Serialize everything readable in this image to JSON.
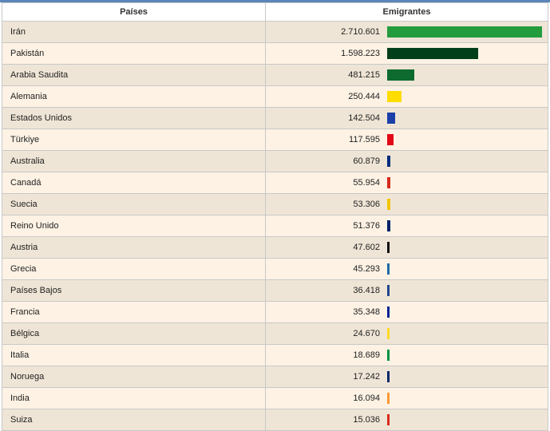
{
  "table": {
    "headers": [
      "Países",
      "Emigrantes"
    ]
  },
  "chart_data": {
    "type": "bar",
    "orientation": "horizontal",
    "xlabel": "",
    "ylabel": "",
    "categories": [
      "Irán",
      "Pakistán",
      "Arabia Saudita",
      "Alemania",
      "Estados Unidos",
      "Türkiye",
      "Australia",
      "Canadá",
      "Suecia",
      "Reino Unido",
      "Austria",
      "Grecia",
      "Países Bajos",
      "Francia",
      "Bélgica",
      "Italia",
      "Noruega",
      "India",
      "Suiza"
    ],
    "values": [
      2710601,
      1598223,
      481215,
      250444,
      142504,
      117595,
      60879,
      55954,
      53306,
      51376,
      47602,
      45293,
      36418,
      35348,
      24670,
      18689,
      17242,
      16094,
      15036
    ],
    "value_labels": [
      "2.710.601",
      "1.598.223",
      "481.215",
      "250.444",
      "142.504",
      "117.595",
      "60.879",
      "55.954",
      "53.306",
      "51.376",
      "47.602",
      "45.293",
      "36.418",
      "35.348",
      "24.670",
      "18.689",
      "17.242",
      "16.094",
      "15.036"
    ],
    "colors": [
      "#239c3e",
      "#013f1a",
      "#0d6b30",
      "#ffdd00",
      "#1c3fa8",
      "#e30a17",
      "#002b7f",
      "#d52b1e",
      "#f2c400",
      "#012169",
      "#111111",
      "#1f6aa5",
      "#21468b",
      "#002395",
      "#fdda24",
      "#009246",
      "#002868",
      "#ff9933",
      "#d52b1e"
    ]
  }
}
